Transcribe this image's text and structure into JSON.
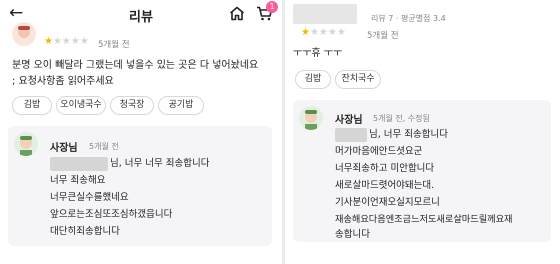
{
  "left": {
    "header": {
      "title": "리뷰",
      "cart_count": "1"
    },
    "review": {
      "stars_filled": 1,
      "stars_total": 5,
      "time": "5개월 전",
      "text_lines": [
        "분명 오이 빼달라 그랬는데 넣을수 있는 곳은 다 넣어놨네요",
        "; 요청사항좀 읽어주세요"
      ],
      "tags": [
        "김밥",
        "오이냉국수",
        "청국장",
        "공기밥"
      ]
    },
    "reply": {
      "author": "사장님",
      "time": "5개월 전",
      "first_line_suffix": "님, 너무 너무 죄송합니다",
      "lines": [
        "너무 죄송해요",
        "너무큰실수를했네요",
        "앞으로는조심또조심하갰읍니다",
        "대단히죄송합니다"
      ]
    }
  },
  "right": {
    "reviewer_meta": "리뷰 7 · 평균별점 3.4",
    "review": {
      "stars_filled": 1,
      "stars_total": 5,
      "time": "5개월 전",
      "text": "ㅜㅜ휴 ㅜㅜ",
      "tags": [
        "김밥",
        "잔치국수"
      ]
    },
    "reply": {
      "author": "사장님",
      "time": "5개월 전, 수정됨",
      "first_line_suffix": "님, 너무 죄송합니다",
      "lines": [
        "머가마음에안드셧요군",
        "너무죄송하고 미안합니다",
        "새로살마드렷어야돼는대.",
        "기사분이언재오실지모르니",
        "재송해요다음엔조금느저도새로살마드릴께요재",
        "송합니다"
      ]
    }
  }
}
